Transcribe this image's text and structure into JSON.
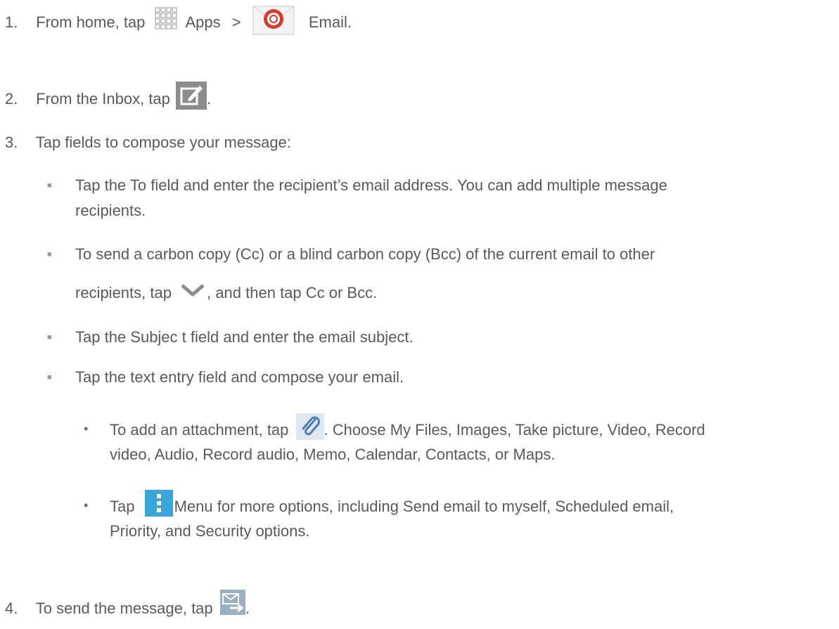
{
  "steps": {
    "s1": {
      "num": "1.",
      "a": "From home, tap",
      "apps": "Apps",
      "sep": ">",
      "email": "Email",
      "end": "."
    },
    "s2": {
      "num": "2.",
      "a": "From the Inbox, tap",
      "end": "."
    },
    "s3": {
      "num": "3.",
      "a": "Tap fields to compose your message:"
    },
    "s4": {
      "num": "4.",
      "a": "To send the message, tap",
      "end": "."
    }
  },
  "bullets": {
    "b1": {
      "line1": "Tap the To field and enter the recipient’s email address. You can add multiple message",
      "line2": "recipients."
    },
    "b2": {
      "line1": "To send a carbon copy (Cc) or a blind carbon copy (Bcc) of the current email to other",
      "line2a": "recipients, tap",
      "line2b": ", and then tap Cc or Bcc."
    },
    "b3": {
      "text": "Tap the Subjec t field and enter the email subject."
    },
    "b4": {
      "text": "Tap the text entry field and compose your email."
    }
  },
  "subbullets": {
    "d1": {
      "a": "To add an attachment, tap",
      "b": ". Choose My Files, Images, Take picture, Video, Record",
      "line2": "video, Audio, Record audio, Memo, Calendar, Contacts, or Maps."
    },
    "d2": {
      "a": "Tap",
      "b": "Menu",
      "c": "for more options, including Send email to myself, Scheduled email,",
      "line2": "Priority, and Security options."
    }
  },
  "icons": {
    "apps": "apps-grid-icon",
    "email": "email-app-icon",
    "compose": "compose-icon",
    "expand": "chevron-down-icon",
    "attach": "paperclip-icon",
    "menu": "menu-icon",
    "send": "send-icon"
  },
  "colors": {
    "text": "#5a5a5a",
    "icon_gray": "#8c8c8c",
    "menu_blue": "#3aa5d8",
    "attach_blue": "#4a7fb0"
  }
}
